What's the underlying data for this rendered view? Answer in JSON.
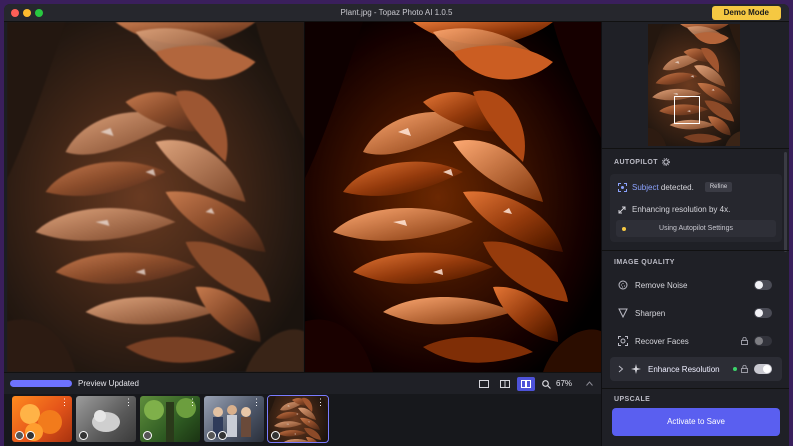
{
  "window": {
    "title": "Plant.jpg - Topaz Photo AI 1.0.5",
    "demo_label": "Demo Mode"
  },
  "status": {
    "preview_label": "Preview Updated",
    "zoom": "67%"
  },
  "autopilot": {
    "title": "AUTOPILOT",
    "subject_keyword": "Subject",
    "subject_suffix": " detected.",
    "refine_label": "Refine",
    "enhancing_text": "Enhancing resolution by 4x.",
    "settings_label": "Using Autopilot Settings"
  },
  "image_quality": {
    "title": "IMAGE QUALITY",
    "items": [
      {
        "label": "Remove Noise",
        "enabled": false
      },
      {
        "label": "Sharpen",
        "enabled": false
      },
      {
        "label": "Recover Faces",
        "enabled": false
      },
      {
        "label": "Enhance Resolution",
        "enabled": true
      }
    ]
  },
  "upscale": {
    "title": "UPSCALE"
  },
  "cta_label": "Activate to Save",
  "filmstrip": [
    {
      "name": "roses"
    },
    {
      "name": "cat"
    },
    {
      "name": "forest"
    },
    {
      "name": "family"
    },
    {
      "name": "plant",
      "selected": true
    }
  ],
  "colors": {
    "accent": "#5a5ff0",
    "demo": "#f5c842",
    "panel": "#1f2026"
  }
}
